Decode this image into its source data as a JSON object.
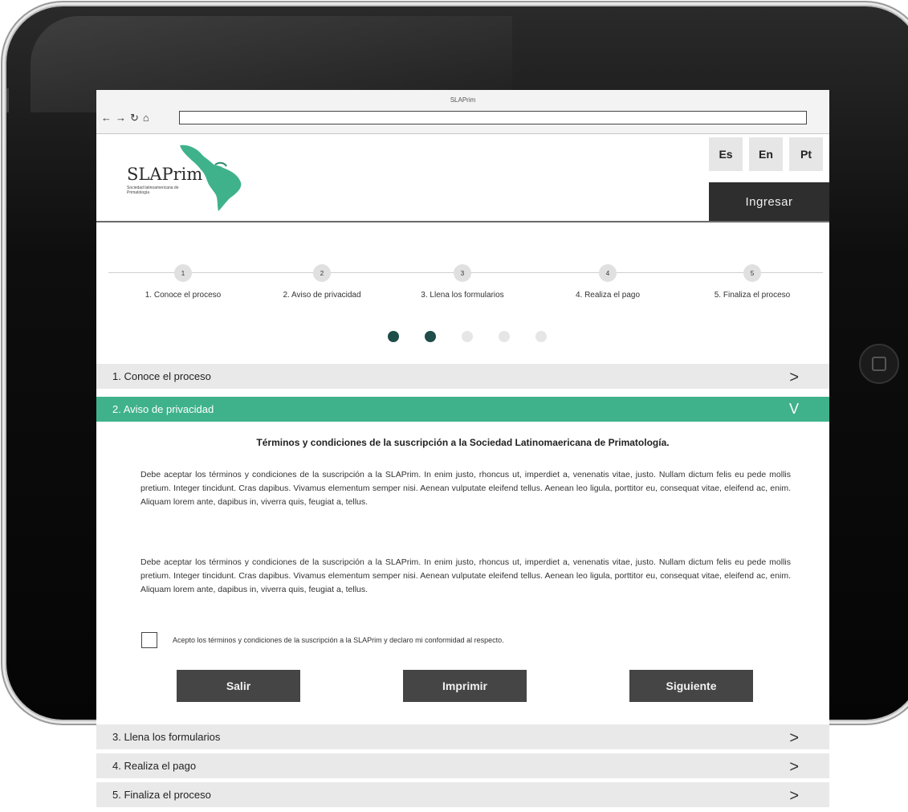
{
  "browser": {
    "title": "SLAPrim",
    "nav_icons": [
      "back-arrow",
      "forward-arrow",
      "reload",
      "home"
    ],
    "url": ""
  },
  "header": {
    "logo_title": "SLAPrim",
    "logo_subtitle": "Sociedad latinoamericana de Primatología",
    "languages": [
      "Es",
      "En",
      "Pt"
    ],
    "login_label": "Ingresar"
  },
  "stepper": {
    "steps": [
      {
        "number": "1",
        "label": "1. Conoce el proceso"
      },
      {
        "number": "2",
        "label": "2. Aviso de privacidad"
      },
      {
        "number": "3",
        "label": "3. Llena los formularios"
      },
      {
        "number": "4",
        "label": "4. Realiza el pago"
      },
      {
        "number": "5",
        "label": "5. Finaliza el proceso"
      }
    ],
    "progress": {
      "completed": 2,
      "total": 5
    },
    "colors": {
      "done": "#1f4d49",
      "pending": "#e6e6e6"
    }
  },
  "accordion": {
    "sections": [
      {
        "label": "1. Conoce el proceso",
        "expanded": false
      },
      {
        "label": "2. Aviso de privacidad",
        "expanded": true
      },
      {
        "label": "3. Llena los formularios",
        "expanded": false
      },
      {
        "label": "4. Realiza el pago",
        "expanded": false
      },
      {
        "label": "5. Finaliza el proceso",
        "expanded": false
      }
    ],
    "active_color": "#3fb28b"
  },
  "privacy": {
    "heading": "Términos y condiciones de la suscripción a la Sociedad Latinomaericana de Primatología.",
    "paragraphs": [
      "Debe aceptar los términos y condiciones de la suscripción a la SLAPrim. In enim justo, rhoncus ut, imperdiet a, venenatis vitae, justo. Nullam dictum felis eu pede mollis pretium. Integer tincidunt. Cras dapibus. Vivamus elementum semper nisi. Aenean vulputate eleifend tellus. Aenean leo ligula, porttitor eu, consequat vitae, eleifend ac, enim. Aliquam lorem ante, dapibus in, viverra quis, feugiat a, tellus.",
      "Debe aceptar los términos y condiciones de la suscripción a la SLAPrim. In enim justo, rhoncus ut, imperdiet a, venenatis vitae, justo. Nullam dictum felis eu pede mollis pretium. Integer tincidunt. Cras dapibus. Vivamus elementum semper nisi. Aenean vulputate eleifend tellus. Aenean leo ligula, porttitor eu, consequat vitae, eleifend ac, enim. Aliquam lorem ante, dapibus in, viverra quis, feugiat a, tellus."
    ],
    "accept_label": "Acepto los términos y condiciones de la suscripción a la SLAPrim y declaro mi conformidad al respecto.",
    "accept_checked": false,
    "buttons": {
      "exit": "Salir",
      "print": "Imprimir",
      "next": "Siguiente"
    }
  }
}
